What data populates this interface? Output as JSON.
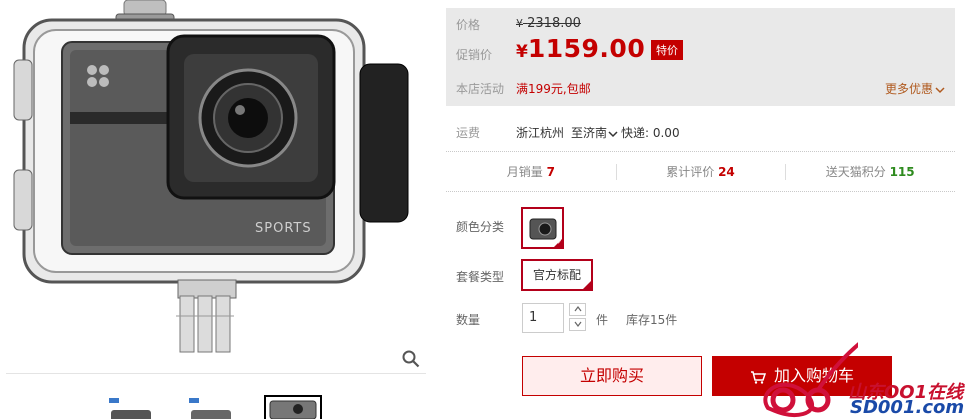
{
  "gallery": {
    "zoom_icon": "search-icon",
    "thumbnail_count": 3,
    "active_thumbnail": 3
  },
  "price": {
    "label": "价格",
    "currency": "¥",
    "original": "2318.00",
    "promo_label": "促销价",
    "promo": "1159.00",
    "tag": "特价",
    "activity_label": "本店活动",
    "activity": "满199元,包邮",
    "more": "更多优惠"
  },
  "shipping": {
    "label": "运费",
    "from": "浙江杭州",
    "to": "至济南",
    "fee": "快递: 0.00"
  },
  "stats": [
    {
      "label": "月销量",
      "value": "7",
      "color": "red"
    },
    {
      "label": "累计评价",
      "value": "24",
      "color": "red"
    },
    {
      "label": "送天猫积分",
      "value": "115",
      "color": "green"
    }
  ],
  "options": {
    "color_label": "颜色分类",
    "package_label": "套餐类型",
    "package_value": "官方标配",
    "qty_label": "数量",
    "qty_value": "1",
    "unit": "件",
    "stock": "库存15件"
  },
  "actions": {
    "buy": "立即购买",
    "cart": "加入购物车"
  },
  "watermark": {
    "line1": "山东OO1在线",
    "line2": "SD001.com"
  },
  "colors": {
    "accent": "#c40000",
    "price_bg": "#e9e9e9",
    "green": "#2e8b1e"
  }
}
